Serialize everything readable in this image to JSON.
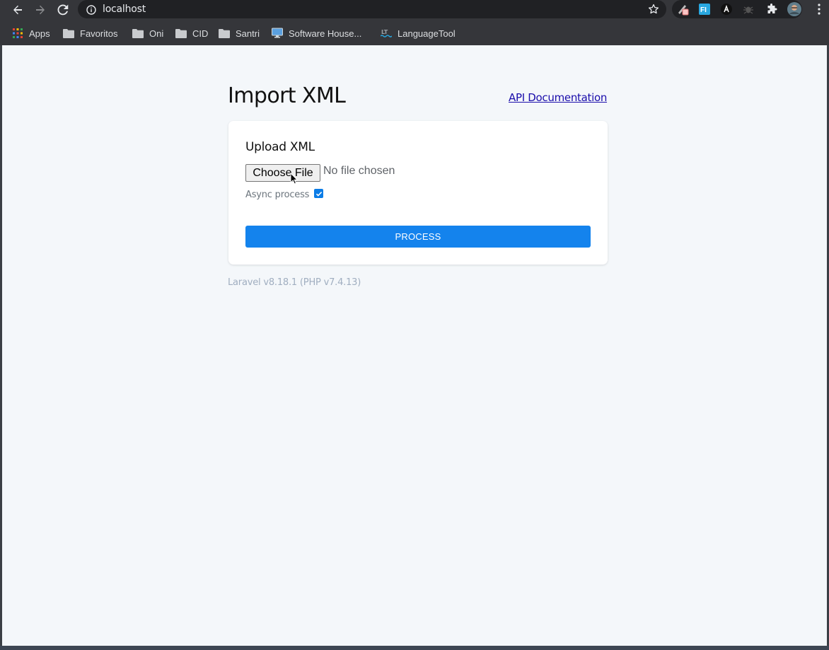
{
  "browser": {
    "url": "localhost",
    "nav": {
      "back": "arrow-left-icon",
      "forward": "arrow-right-icon",
      "reload": "reload-icon"
    },
    "bookmarks": [
      {
        "label": "Apps",
        "icon": "apps-grid-icon"
      },
      {
        "label": "Favoritos",
        "icon": "folder-icon"
      },
      {
        "label": "Oni",
        "icon": "folder-icon"
      },
      {
        "label": "CID",
        "icon": "folder-icon"
      },
      {
        "label": "Santri",
        "icon": "folder-icon"
      },
      {
        "label": "Software House...",
        "icon": "monitor-icon"
      },
      {
        "label": "LanguageTool",
        "icon": "languagetool-icon"
      }
    ],
    "extensions": [
      {
        "icon": "pen-extension-icon",
        "color": "#e57373"
      },
      {
        "icon": "fi-extension-icon",
        "color": "#29a8e0"
      },
      {
        "icon": "lambda-extension-icon",
        "color": "#ffffff"
      },
      {
        "icon": "bug-extension-icon",
        "color": "#666666"
      },
      {
        "icon": "puzzle-icon",
        "color": "#e8eaed"
      },
      {
        "icon": "profile-avatar-icon",
        "color": "#607d8b"
      }
    ]
  },
  "page": {
    "title": "Import XML",
    "api_link": "API Documentation",
    "form": {
      "heading": "Upload XML",
      "file_button": "Choose File",
      "file_status": "No file chosen",
      "async_label": "Async process",
      "async_checked": true,
      "submit_label": "PROCESS"
    },
    "footer": "Laravel v8.18.1 (PHP v7.4.13)"
  },
  "colors": {
    "accent": "#1483ed",
    "page_bg": "#f4f7fa",
    "chrome_bg": "#35363a",
    "link": "#1a0dab"
  }
}
